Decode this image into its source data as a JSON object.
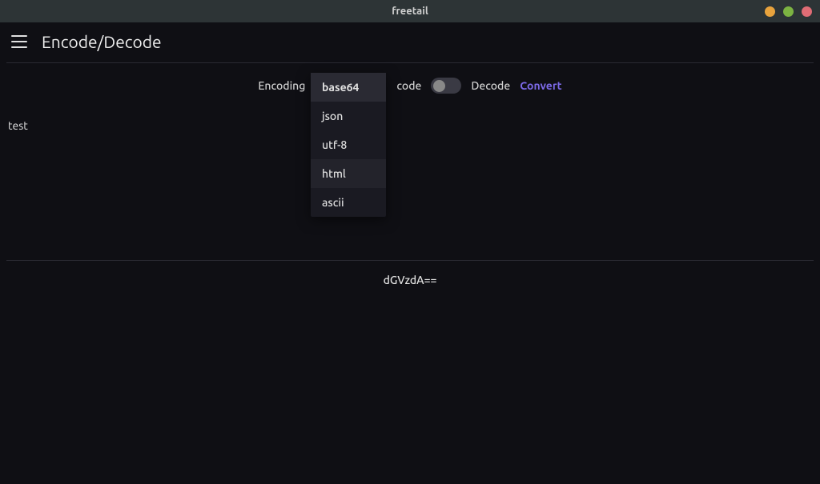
{
  "window": {
    "title": "freetail"
  },
  "header": {
    "title": "Encode/Decode"
  },
  "toolbar": {
    "encoding_label": "Encoding",
    "encode_label": "Encode",
    "encode_partial": "code",
    "decode_label": "Decode",
    "convert_label": "Convert"
  },
  "dropdown": {
    "options": [
      {
        "label": "base64",
        "selected": true,
        "hovered": false
      },
      {
        "label": "json",
        "selected": false,
        "hovered": false
      },
      {
        "label": "utf-8",
        "selected": false,
        "hovered": false
      },
      {
        "label": "html",
        "selected": false,
        "hovered": true
      },
      {
        "label": "ascii",
        "selected": false,
        "hovered": false
      }
    ]
  },
  "input": {
    "value": "test"
  },
  "output": {
    "value": "dGVzdA=="
  }
}
